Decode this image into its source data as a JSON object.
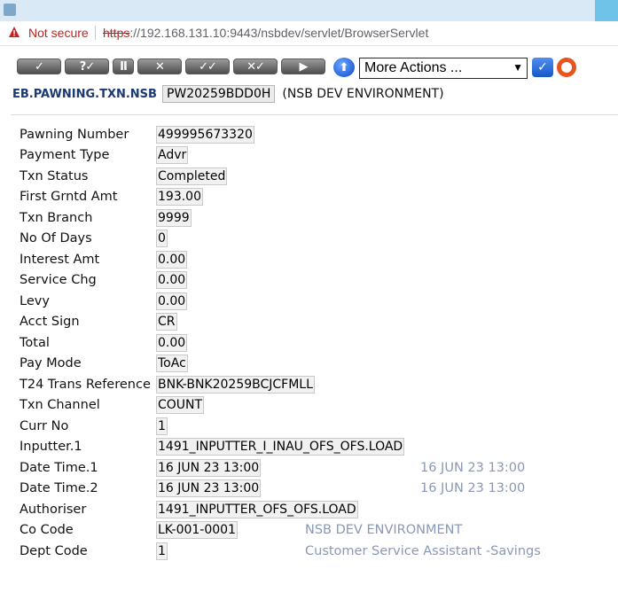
{
  "browser": {
    "security_label": "Not secure",
    "url_scheme": "https",
    "url_rest": "://192.168.131.10:9443/nsbdev/servlet/BrowserServlet"
  },
  "toolbar": {
    "buttons": [
      {
        "icon": "commit-icon",
        "glyph": "✓"
      },
      {
        "icon": "validate-icon",
        "glyph": "?✓"
      },
      {
        "icon": "hold-icon",
        "glyph": "II"
      },
      {
        "icon": "delete-icon",
        "glyph": "✕"
      },
      {
        "icon": "authorise-icon",
        "glyph": "✓✓"
      },
      {
        "icon": "reverse-icon",
        "glyph": "✕✓"
      },
      {
        "icon": "next-icon",
        "glyph": "▶"
      }
    ],
    "more_actions": "More Actions ...",
    "go_glyph": "✓"
  },
  "header": {
    "app_name": "EB.PAWNING.TXN.NSB",
    "record_id": "PW20259BDD0H",
    "environment": "(NSB DEV ENVIRONMENT)"
  },
  "fields": [
    {
      "label": "Pawning Number",
      "value": "499995673320"
    },
    {
      "label": "Payment Type",
      "value": "Advr"
    },
    {
      "label": "Txn Status",
      "value": "Completed"
    },
    {
      "label": "First Grntd Amt",
      "value": "193.00"
    },
    {
      "label": "Txn Branch",
      "value": "9999"
    },
    {
      "label": "No Of Days",
      "value": "0"
    },
    {
      "label": "Interest Amt",
      "value": "0.00"
    },
    {
      "label": "Service Chg",
      "value": "0.00"
    },
    {
      "label": "Levy",
      "value": "0.00"
    },
    {
      "label": "Acct Sign",
      "value": "CR"
    },
    {
      "label": "Total",
      "value": "0.00"
    },
    {
      "label": "Pay Mode",
      "value": "ToAc"
    },
    {
      "label": "T24 Trans Reference",
      "value": "BNK-BNK20259BCJCFMLL"
    },
    {
      "label": "Txn Channel",
      "value": "COUNT"
    },
    {
      "label": "Curr No",
      "value": "1"
    },
    {
      "label": "Inputter.1",
      "value": "1491_INPUTTER_I_INAU_OFS_OFS.LOAD"
    },
    {
      "label": "Date Time.1",
      "value": "16 JUN 23 13:00",
      "enrichment": "16 JUN 23 13:00"
    },
    {
      "label": "Date Time.2",
      "value": "16 JUN 23 13:00",
      "enrichment": "16 JUN 23 13:00"
    },
    {
      "label": "Authoriser",
      "value": "1491_INPUTTER_OFS_OFS.LOAD"
    },
    {
      "label": "Co Code",
      "value": "LK-001-0001",
      "enrichment": "NSB DEV ENVIRONMENT"
    },
    {
      "label": "Dept Code",
      "value": "1",
      "enrichment": "Customer Service Assistant -Savings"
    }
  ],
  "colors": {
    "not_secure": "#c5221f",
    "app_name": "#1b3a73",
    "enrichment": "#8a98b6",
    "titlebar": "#d9eaf6"
  }
}
